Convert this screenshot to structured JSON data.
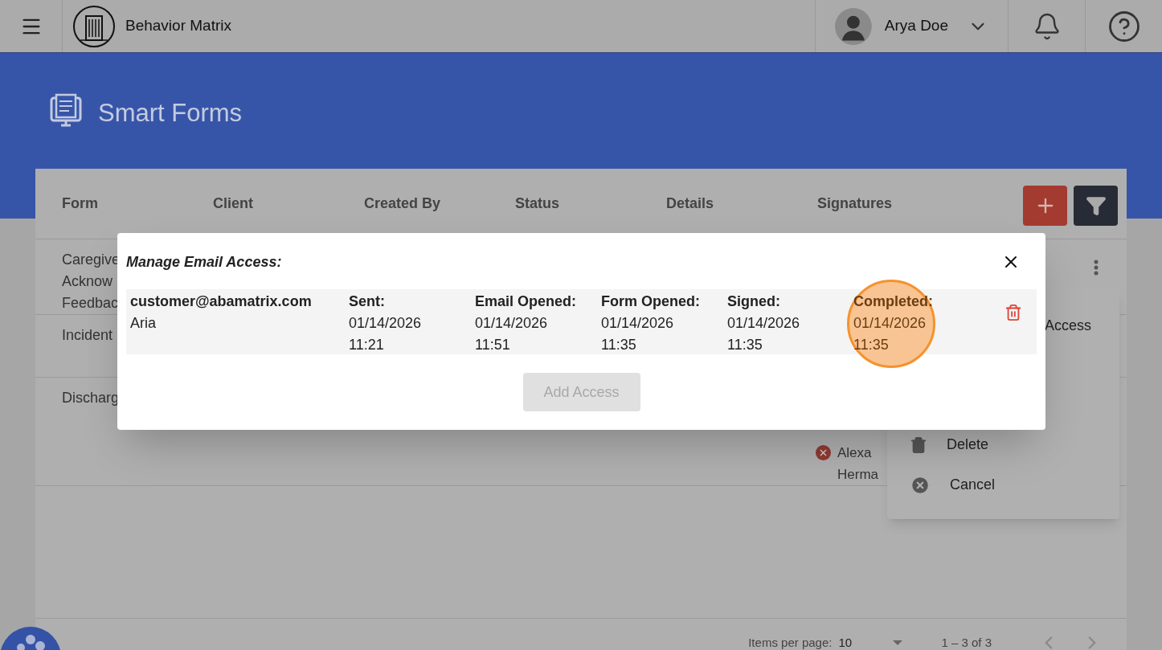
{
  "header": {
    "app_name": "Behavior Matrix",
    "user_name": "Arya Doe"
  },
  "page_title": "Smart Forms",
  "table": {
    "columns": [
      "Form",
      "Client",
      "Created By",
      "Status",
      "Details",
      "Signatures"
    ],
    "rows": [
      {
        "form_lines": [
          "Caregive",
          "Acknow",
          "Feedbac"
        ],
        "signatures": []
      },
      {
        "form_lines": [
          "Incident"
        ],
        "signatures": []
      },
      {
        "form_lines": [
          "Discharg"
        ],
        "signatures": [
          {
            "name_lines": [
              "Alexa",
              "Herma"
            ],
            "signed": false
          }
        ]
      }
    ]
  },
  "row_menu": {
    "items": [
      {
        "kind": "access",
        "label": "Access"
      },
      {
        "kind": "delete",
        "label": "Delete"
      },
      {
        "kind": "cancel",
        "label": "Cancel"
      }
    ]
  },
  "pagination": {
    "items_label": "Items per page:",
    "page_size": "10",
    "range": "1 – 3 of 3"
  },
  "dialog": {
    "title": "Manage Email Access:",
    "entries": [
      {
        "email": "customer@abamatrix.com",
        "name": "Aria",
        "events": [
          {
            "label": "Sent:",
            "date": "01/14/2026",
            "time": "11:21",
            "highlighted": false
          },
          {
            "label": "Email Opened:",
            "date": "01/14/2026",
            "time": "11:51",
            "highlighted": false
          },
          {
            "label": "Form Opened:",
            "date": "01/14/2026",
            "time": "11:35",
            "highlighted": false
          },
          {
            "label": "Signed:",
            "date": "01/14/2026",
            "time": "11:35",
            "highlighted": false
          },
          {
            "label": "Completed:",
            "date": "01/14/2026",
            "time": "11:35",
            "highlighted": true
          }
        ]
      }
    ],
    "add_button": {
      "label": "Add Access",
      "disabled": true
    }
  }
}
